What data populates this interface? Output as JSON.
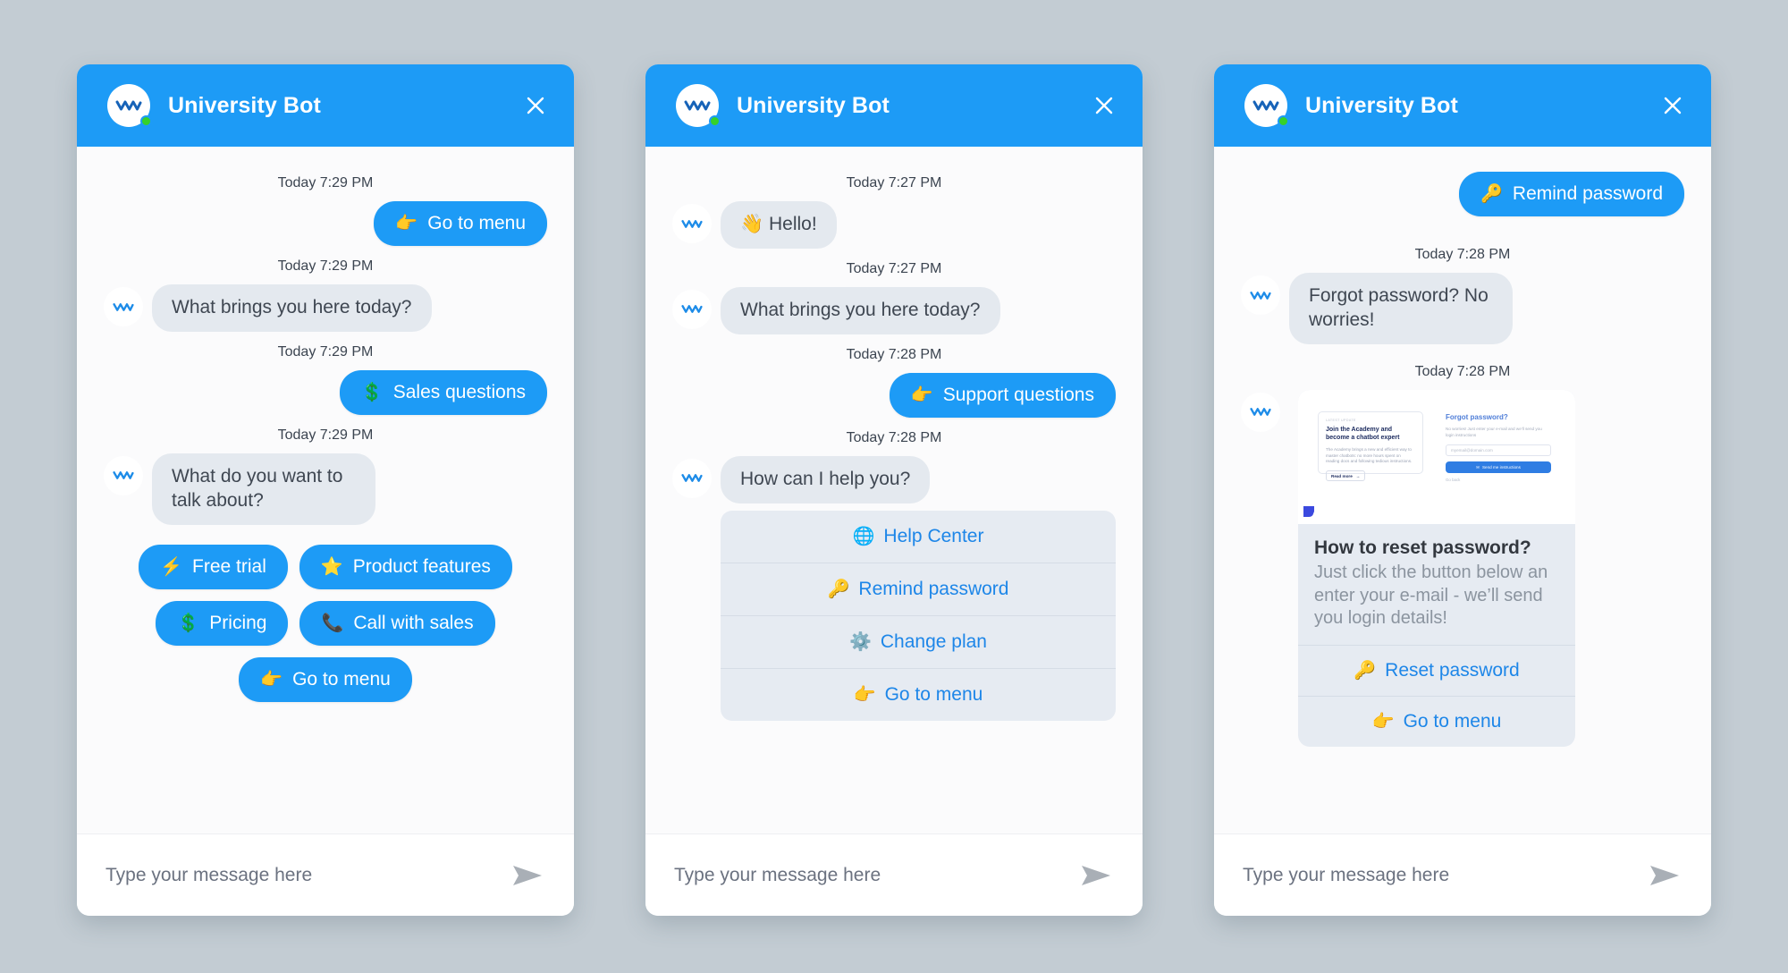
{
  "theme": {
    "accent": "#1d9bf6",
    "bubble_bg": "#e4e9ef",
    "card_bg": "#e6ebf2",
    "page_bg": "#c3ccd3",
    "link_blue": "#1d86e8",
    "online_green": "#36d12a"
  },
  "header": {
    "title": "University Bot",
    "close_label": "×",
    "avatar_icon": "bot-wave-icon",
    "status": "online"
  },
  "footer": {
    "placeholder": "Type your message here",
    "value": "",
    "send_icon": "send-icon"
  },
  "panels": [
    {
      "id": "panel-1",
      "messages": [
        {
          "type": "timestamp",
          "text": "Today 7:29 PM"
        },
        {
          "type": "user-chip",
          "emoji": "👉",
          "text": "Go to menu"
        },
        {
          "type": "timestamp",
          "text": "Today 7:29 PM"
        },
        {
          "type": "bot-bubble",
          "text": "What brings you here today?"
        },
        {
          "type": "timestamp",
          "text": "Today 7:29 PM"
        },
        {
          "type": "user-chip",
          "emoji": "💲",
          "text": "Sales questions"
        },
        {
          "type": "timestamp",
          "text": "Today 7:29 PM"
        },
        {
          "type": "bot-bubble",
          "text": "What do you want to talk about?"
        }
      ],
      "quick_replies": [
        {
          "emoji": "⚡",
          "text": "Free trial"
        },
        {
          "emoji": "⭐",
          "text": "Product features"
        },
        {
          "emoji": "💲",
          "text": "Pricing"
        },
        {
          "emoji": "📞",
          "text": "Call with sales"
        },
        {
          "emoji": "👉",
          "text": "Go to menu"
        }
      ]
    },
    {
      "id": "panel-2",
      "messages": [
        {
          "type": "timestamp",
          "text": "Today 7:27 PM"
        },
        {
          "type": "bot-bubble",
          "emoji": "👋",
          "text": "Hello!"
        },
        {
          "type": "timestamp",
          "text": "Today 7:27 PM"
        },
        {
          "type": "bot-bubble",
          "text": "What brings you here today?"
        },
        {
          "type": "timestamp",
          "text": "Today 7:28 PM"
        },
        {
          "type": "user-chip",
          "emoji": "👉",
          "text": "Support questions"
        },
        {
          "type": "timestamp",
          "text": "Today 7:28 PM"
        },
        {
          "type": "bot-bubble",
          "text": "How can I help you?"
        }
      ],
      "menu_items": [
        {
          "emoji": "🌐",
          "text": "Help Center"
        },
        {
          "emoji": "🔑",
          "text": "Remind password"
        },
        {
          "emoji": "⚙️",
          "text": "Change plan"
        },
        {
          "emoji": "👉",
          "text": "Go to menu"
        }
      ]
    },
    {
      "id": "panel-3",
      "messages": [
        {
          "type": "user-chip",
          "emoji": "🔑",
          "text": "Remind password"
        },
        {
          "type": "timestamp",
          "text": "Today 7:28 PM"
        },
        {
          "type": "bot-bubble",
          "text": "Forgot password? No worries!"
        },
        {
          "type": "timestamp",
          "text": "Today 7:28 PM"
        }
      ],
      "card": {
        "title": "How to reset password?",
        "description": "Just click the button below an enter your e-mail - we’ll send you login details!",
        "preview": {
          "left_kicker": "LATEST UPDATE",
          "left_title": "Join the Academy and become a chatbot expert",
          "left_body": "The Academy brings a new and efficient way to master chatbots: no more hours spent on reading docs and following tedious instructions.",
          "left_button": "Read more",
          "right_title": "Forgot password?",
          "right_body": "No worries! Just enter your e-mail and we’ll send you login instructions",
          "right_input": "myemail@domain.com",
          "right_button": "Send me instructions",
          "right_link": "Go back"
        },
        "actions": [
          {
            "emoji": "🔑",
            "text": "Reset password"
          },
          {
            "emoji": "👉",
            "text": "Go to menu"
          }
        ]
      }
    }
  ]
}
